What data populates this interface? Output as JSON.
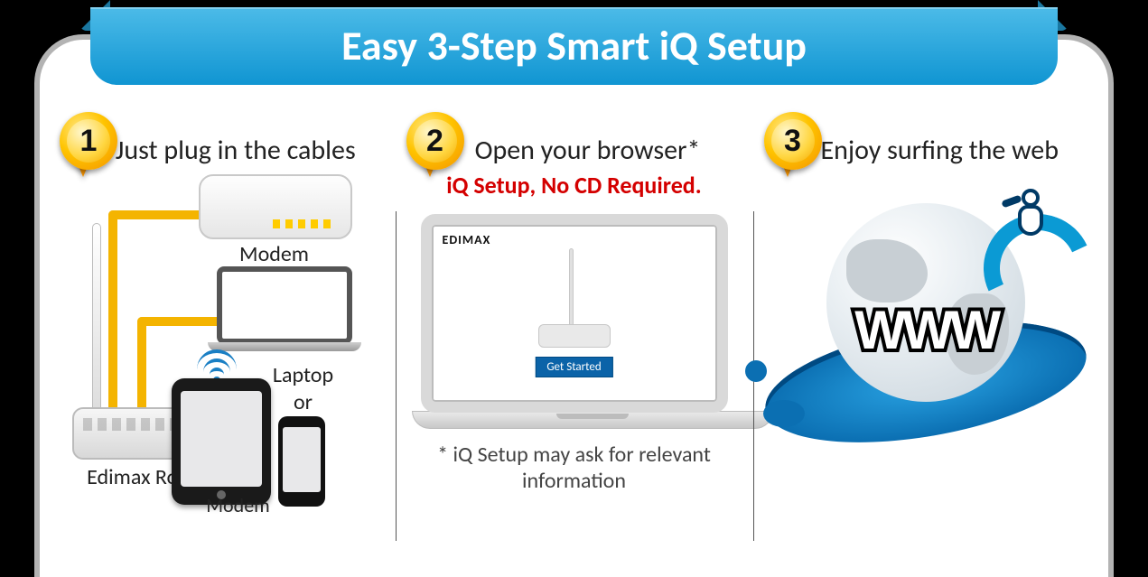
{
  "header": {
    "title": "Easy 3-Step Smart iQ Setup"
  },
  "steps": [
    {
      "number": "1",
      "title": "Just plug  in the cables",
      "labels": {
        "modem": "Modem",
        "router": "Edimax Router",
        "laptop": "Laptop",
        "or": "or",
        "modem2": "Modem"
      }
    },
    {
      "number": "2",
      "title": "Open your browser*",
      "subtitle": "iQ Setup, No CD Required.",
      "screen": {
        "brand": "EDIMAX",
        "button": "Get Started"
      },
      "footnote": "* iQ Setup may ask for relevant information"
    },
    {
      "number": "3",
      "title": "Enjoy surfing the web",
      "www_text": "WWW"
    }
  ]
}
